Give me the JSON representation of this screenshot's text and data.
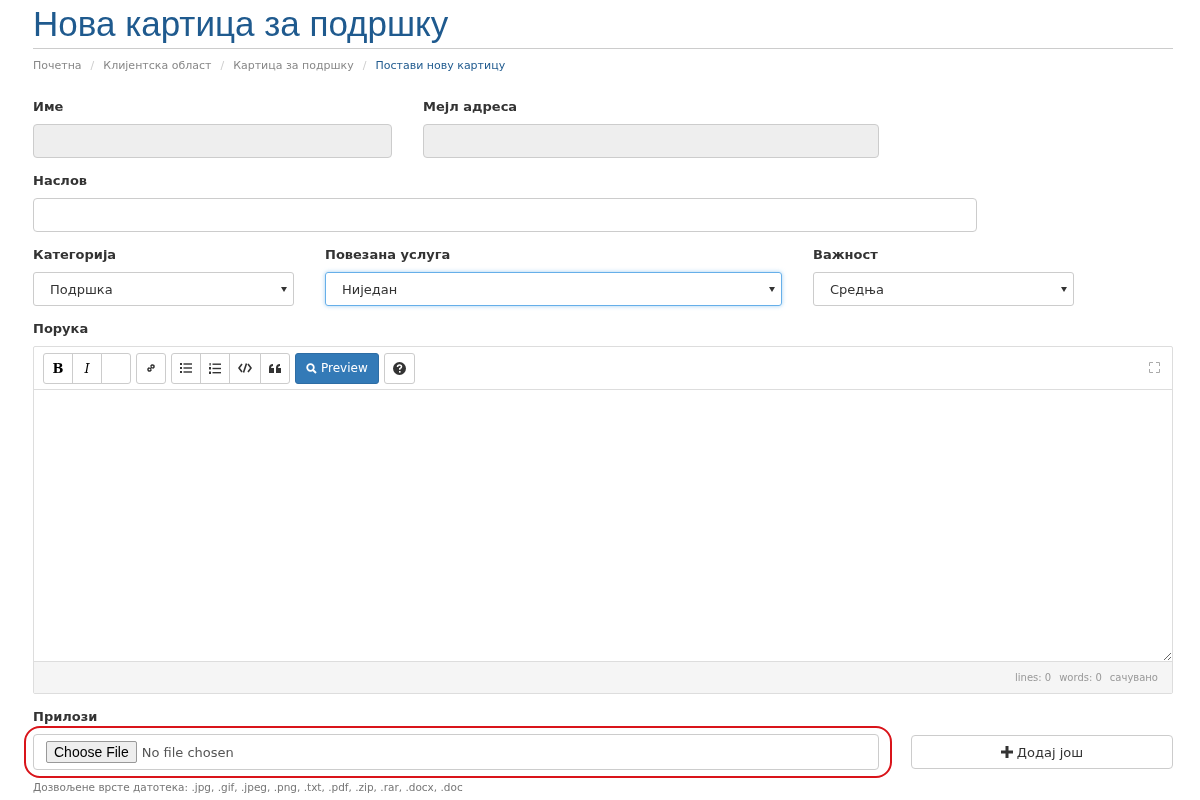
{
  "page_title": "Нова картица за подршку",
  "breadcrumb_separator": "/",
  "breadcrumb": [
    {
      "label": "Почетна",
      "current": false
    },
    {
      "label": "Клијентска област",
      "current": false
    },
    {
      "label": "Картица за подршку",
      "current": false
    },
    {
      "label": "Постави нову картицу",
      "current": true
    }
  ],
  "form": {
    "name": {
      "label": "Име",
      "disabled": true
    },
    "email": {
      "label": "Мејл адреса",
      "disabled": true
    },
    "subject": {
      "label": "Наслов"
    },
    "department": {
      "label": "Категорија",
      "value": "Подршка",
      "focused": false
    },
    "related_service": {
      "label": "Повезана услуга",
      "value": "Ниједан",
      "focused": true
    },
    "priority": {
      "label": "Важност",
      "value": "Средња",
      "focused": false
    },
    "message": {
      "label": "Порука",
      "toolbar": [
        [
          {
            "kind": "bold",
            "text": "B"
          },
          {
            "kind": "italic",
            "text": "I"
          },
          {
            "kind": "blank"
          }
        ],
        [
          {
            "kind": "link"
          }
        ],
        [
          {
            "kind": "bullets"
          },
          {
            "kind": "numbers"
          },
          {
            "kind": "code"
          },
          {
            "kind": "quote"
          }
        ],
        [
          {
            "kind": "preview",
            "text": "Preview"
          }
        ],
        [
          {
            "kind": "help"
          }
        ]
      ],
      "status": [
        "lines: 0",
        "words: 0",
        "сачувано"
      ]
    },
    "attachments": {
      "label": "Прилози",
      "choose_button": "Choose File",
      "file_status": "No file chosen",
      "highlighted": true,
      "add_button": "Додај још",
      "hint": "Дозвољене врсте датотека: .jpg, .gif, .jpeg, .png, .txt, .pdf, .zip, .rar, .docx, .doc"
    }
  }
}
